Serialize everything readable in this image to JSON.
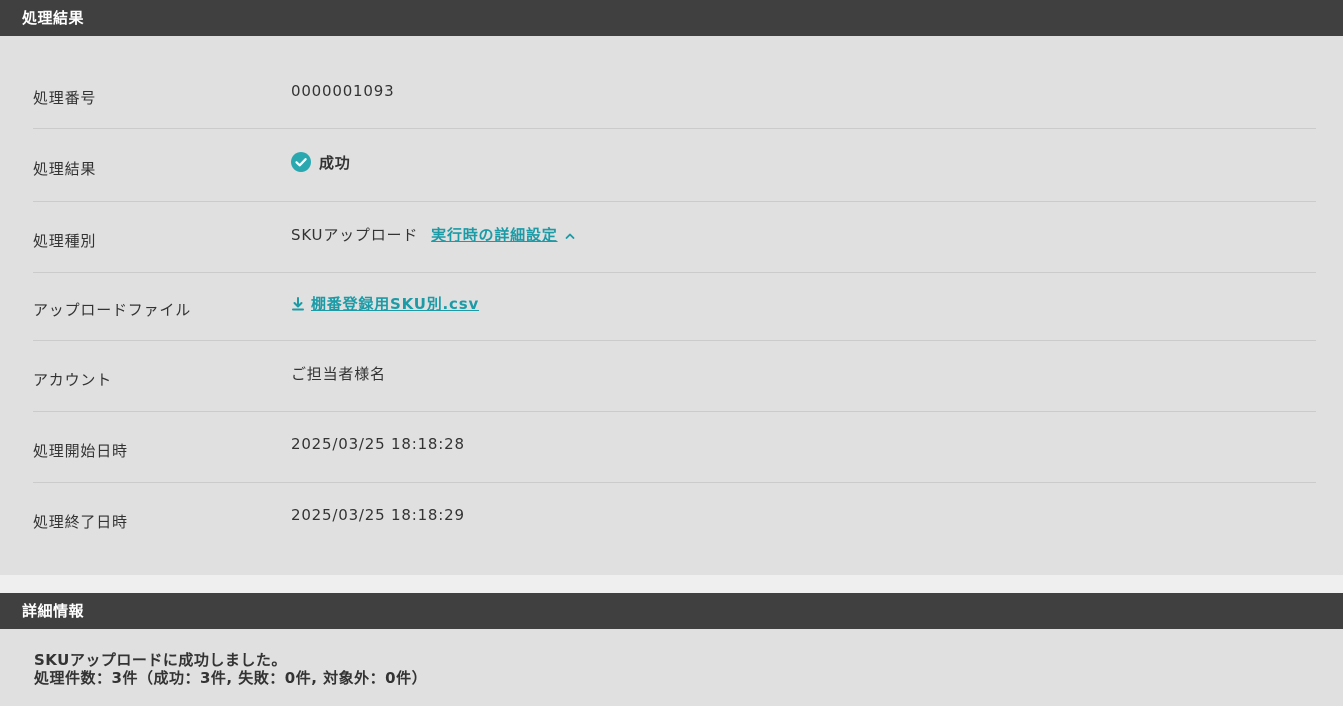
{
  "result_section": {
    "title": "処理結果",
    "rows": {
      "process_number": {
        "label": "処理番号",
        "value": "0000001093"
      },
      "process_result": {
        "label": "処理結果",
        "value": "成功",
        "status_icon": "check-circle-icon",
        "status_color": "#2aa8b0"
      },
      "process_type": {
        "label": "処理種別",
        "value": "SKUアップロード",
        "link": "実行時の詳細設定",
        "link_icon": "chevron-up-icon"
      },
      "upload_file": {
        "label": "アップロードファイル",
        "file": "棚番登録用SKU別.csv",
        "icon": "download-icon"
      },
      "account": {
        "label": "アカウント",
        "value": "ご担当者様名"
      },
      "start_time": {
        "label": "処理開始日時",
        "value": "2025/03/25 18:18:28"
      },
      "end_time": {
        "label": "処理終了日時",
        "value": "2025/03/25 18:18:29"
      }
    }
  },
  "detail_section": {
    "title": "詳細情報",
    "message_line1": "SKUアップロードに成功しました。",
    "message_line2": "処理件数：3件（成功：3件, 失敗：0件, 対象外：0件）"
  },
  "colors": {
    "header_bg": "#404040",
    "panel_bg": "#e0e0e0",
    "accent": "#1c9ba6"
  }
}
